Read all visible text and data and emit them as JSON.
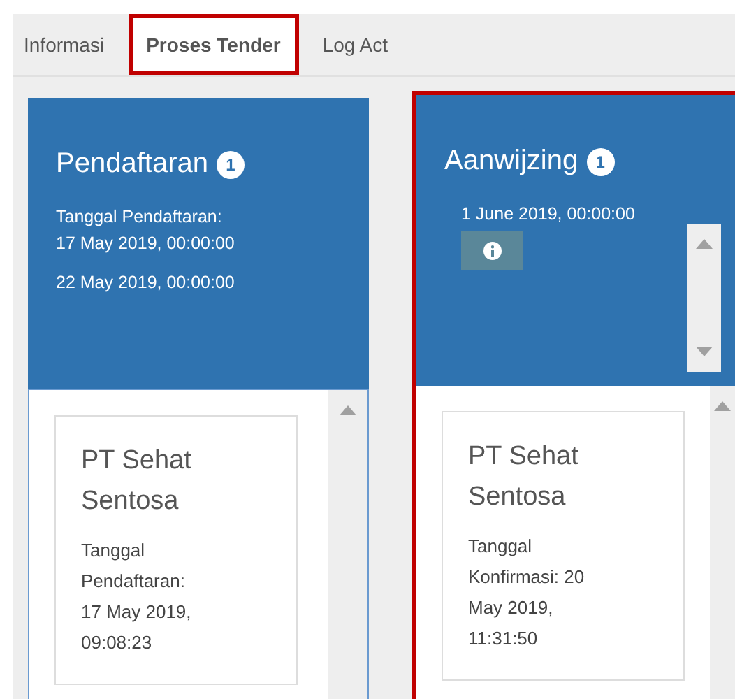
{
  "tabs": [
    {
      "label": "Informasi",
      "selected": false,
      "highlighted": false
    },
    {
      "label": "Proses Tender",
      "selected": true,
      "highlighted": true
    },
    {
      "label": "Log Act",
      "selected": false,
      "highlighted": false
    }
  ],
  "columns": [
    {
      "title": "Pendaftaran",
      "count": "1",
      "highlighted": false,
      "header_scrollbar": false,
      "info_button": false,
      "dates": [
        "Tanggal Pendaftaran:\n17 May 2019, 00:00:00",
        "22 May 2019, 00:00:00"
      ],
      "cards": [
        {
          "name": "PT Sehat Sentosa",
          "detail": "Tanggal Pendaftaran: 17 May 2019, 09:08:23"
        }
      ]
    },
    {
      "title": "Aanwijzing",
      "count": "1",
      "highlighted": true,
      "header_scrollbar": true,
      "info_button": true,
      "dates": [
        "1 June 2019, 00:00:00"
      ],
      "cards": [
        {
          "name": "PT Sehat Sentosa",
          "detail": "Tanggal Konfirmasi: 20 May 2019, 11:31:50"
        }
      ]
    }
  ]
}
